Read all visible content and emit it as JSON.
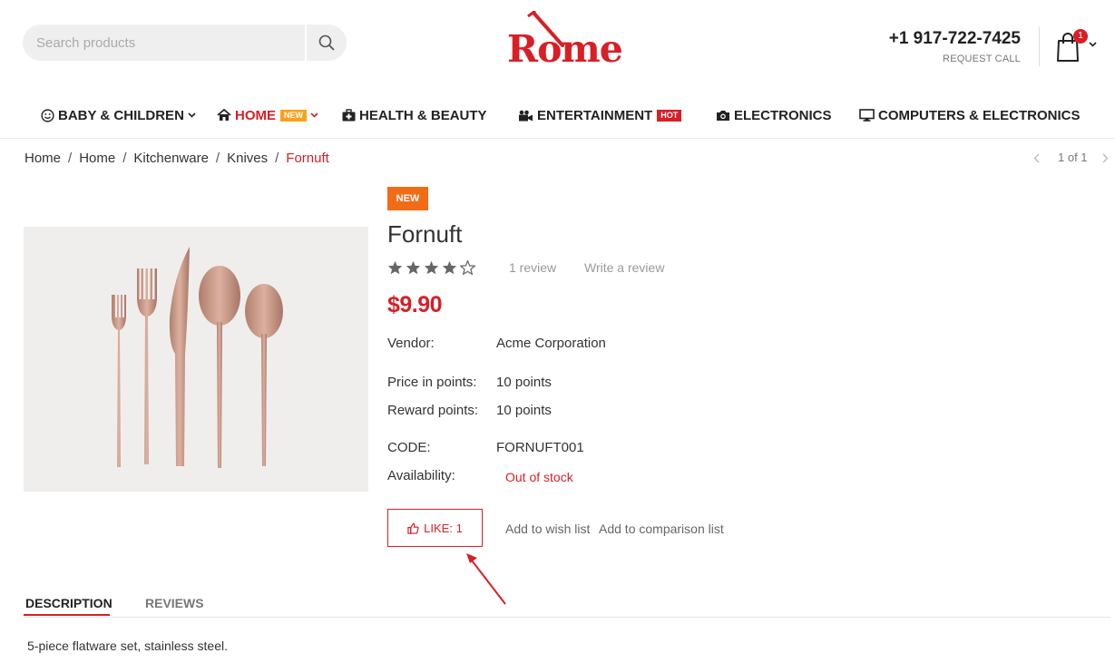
{
  "header": {
    "search_placeholder": "Search products",
    "logo_text": "Rome",
    "phone": "+1 917-722-7425",
    "request_call": "REQUEST CALL",
    "cart_count": "1",
    "accent_color": "#d71f26"
  },
  "nav": {
    "items": [
      {
        "label": "BABY & CHILDREN",
        "icon": "smiley-icon",
        "has_dropdown": true
      },
      {
        "label": "HOME",
        "icon": "home-icon",
        "tag": "NEW",
        "has_dropdown": true,
        "active": true
      },
      {
        "label": "HEALTH & BEAUTY",
        "icon": "medical-kit-icon"
      },
      {
        "label": "ENTERTAINMENT",
        "icon": "video-camera-icon",
        "tag": "HOT"
      },
      {
        "label": "ELECTRONICS",
        "icon": "camera-icon"
      },
      {
        "label": "COMPUTERS & ELECTRONICS",
        "icon": "monitor-icon"
      }
    ]
  },
  "breadcrumb": {
    "items": [
      "Home",
      "Home",
      "Kitchenware",
      "Knives",
      "Fornuft"
    ],
    "separator": "/"
  },
  "pager": {
    "text": "1 of 1"
  },
  "product": {
    "badge": "NEW",
    "title": "Fornuft",
    "rating": 4,
    "rating_max": 5,
    "review_count": "1 review",
    "write_review": "Write a review",
    "price": "$9.90",
    "vendor_label": "Vendor:",
    "vendor": "Acme Corporation",
    "price_points_label": "Price in points:",
    "price_points": "10 points",
    "reward_points_label": "Reward points:",
    "reward_points": "10 points",
    "code_label": "CODE:",
    "code": "FORNUFT001",
    "availability_label": "Availability:",
    "availability": "Out of stock",
    "like_label": "LIKE: 1",
    "wish_list": "Add to wish list",
    "comparison_list": "Add to comparison list"
  },
  "tabs": {
    "description": "DESCRIPTION",
    "reviews": "REVIEWS"
  },
  "description_text": "5-piece flatware set, stainless steel."
}
